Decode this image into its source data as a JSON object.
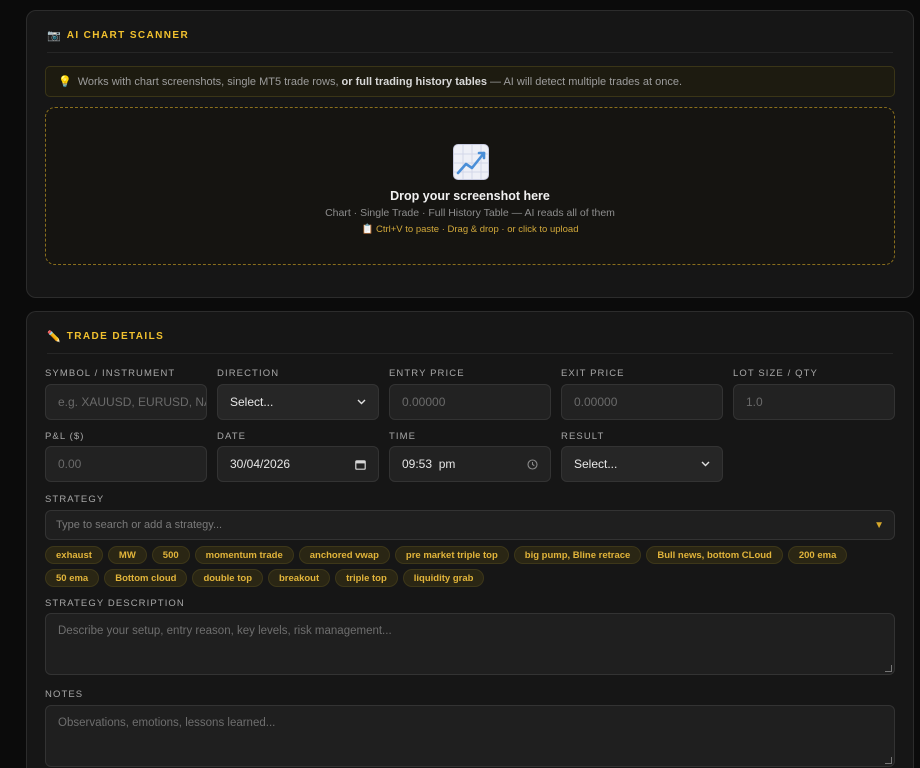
{
  "scanner": {
    "icon": "camera-icon",
    "title": "AI CHART SCANNER",
    "tip_icon": "lightbulb-icon",
    "tip_prefix": "Works with chart screenshots, single MT5 trade rows,",
    "tip_bold": "or full trading history tables",
    "tip_suffix": "— AI will detect multiple trades at once.",
    "drop_icon": "chart-increasing-icon",
    "drop_title": "Drop your screenshot here",
    "drop_sub": "Chart · Single Trade · Full History Table — AI reads all of them",
    "drop_hint_icon": "clipboard-icon",
    "drop_hint": "Ctrl+V to paste · Drag & drop · or click to upload",
    "accent_color": "#f2c12e"
  },
  "details": {
    "icon": "pencil-icon",
    "title": "TRADE DETAILS",
    "symbol": {
      "label": "SYMBOL / INSTRUMENT",
      "placeholder": "e.g. XAUUSD, EURUSD, NAS100"
    },
    "direction": {
      "label": "DIRECTION",
      "value": "Select..."
    },
    "entry": {
      "label": "ENTRY PRICE",
      "placeholder": "0.00000"
    },
    "exit": {
      "label": "EXIT PRICE",
      "placeholder": "0.00000"
    },
    "lot": {
      "label": "LOT SIZE / QTY",
      "placeholder": "1.0"
    },
    "pnl": {
      "label": "P&L ($)",
      "placeholder": "0.00"
    },
    "date": {
      "label": "DATE",
      "value": "30/04/2026"
    },
    "time": {
      "label": "TIME",
      "value": "09:53  pm"
    },
    "result": {
      "label": "RESULT",
      "value": "Select..."
    },
    "strategy": {
      "label": "STRATEGY",
      "placeholder": "Type to search or add a strategy...",
      "tags": [
        "exhaust",
        "MW",
        "500",
        "momentum trade",
        "anchored vwap",
        "pre market triple top",
        "big pump, Bline retrace",
        "Bull news, bottom CLoud",
        "200 ema",
        "50 ema",
        "Bottom cloud",
        "double top",
        "breakout",
        "triple top",
        "liquidity grab"
      ]
    },
    "description": {
      "label": "STRATEGY DESCRIPTION",
      "placeholder": "Describe your setup, entry reason, key levels, risk management..."
    },
    "notes": {
      "label": "NOTES",
      "placeholder": "Observations, emotions, lessons learned..."
    }
  }
}
